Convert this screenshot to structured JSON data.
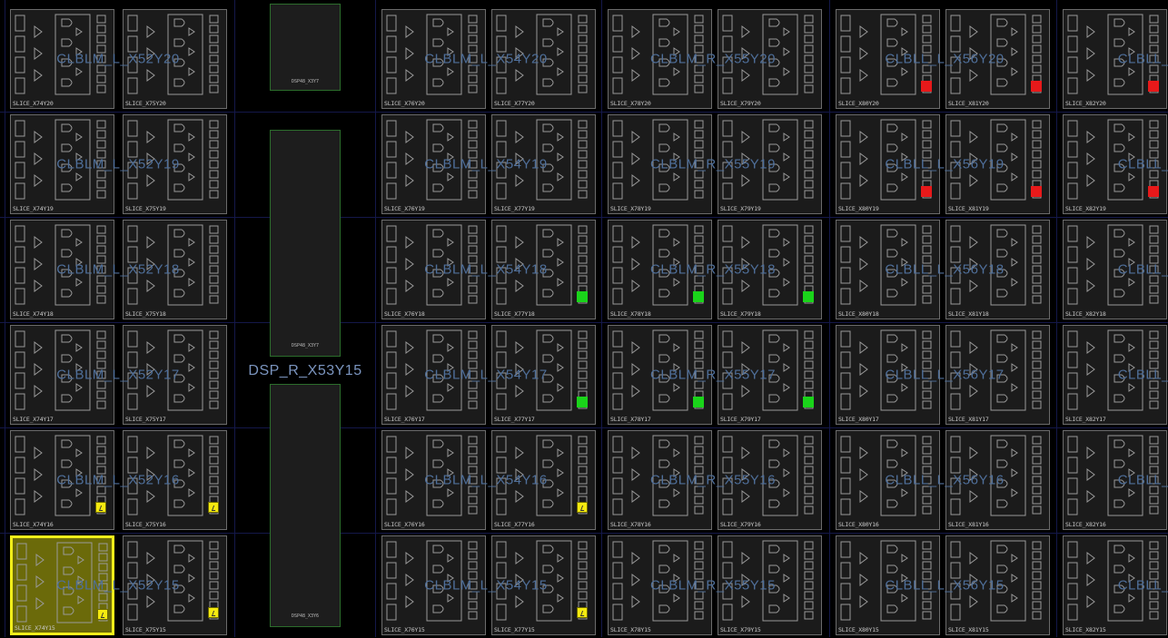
{
  "view": {
    "colors": {
      "background": "#000000",
      "slice_fill": "#1b1b1b",
      "slice_border": "#6b6b6b",
      "selected_fill": "#6b6a0a",
      "selected_border": "#f2ee1a",
      "marker_red": "#e8191a",
      "marker_green": "#1ad41a",
      "marker_yellow": "#f5ea10",
      "tile_label": "#4f6f9a",
      "dsp_border": "#2c6d2c"
    }
  },
  "rows": [
    {
      "y": 20,
      "slices": [
        {
          "label": "SLICE_X74Y20",
          "marker": null
        },
        {
          "label": "SLICE_X75Y20",
          "marker": null
        },
        {
          "label": "SLICE_X76Y20",
          "marker": null
        },
        {
          "label": "SLICE_X77Y20",
          "marker": null
        },
        {
          "label": "SLICE_X78Y20",
          "marker": null
        },
        {
          "label": "SLICE_X79Y20",
          "marker": null
        },
        {
          "label": "SLICE_X80Y20",
          "marker": "red"
        },
        {
          "label": "SLICE_X81Y20",
          "marker": "red"
        },
        {
          "label": "SLICE_X82Y20",
          "marker": "red"
        }
      ]
    },
    {
      "y": 19,
      "slices": [
        {
          "label": "SLICE_X74Y19",
          "marker": null
        },
        {
          "label": "SLICE_X75Y19",
          "marker": null
        },
        {
          "label": "SLICE_X76Y19",
          "marker": null
        },
        {
          "label": "SLICE_X77Y19",
          "marker": null
        },
        {
          "label": "SLICE_X78Y19",
          "marker": null
        },
        {
          "label": "SLICE_X79Y19",
          "marker": null
        },
        {
          "label": "SLICE_X80Y19",
          "marker": "red"
        },
        {
          "label": "SLICE_X81Y19",
          "marker": "red"
        },
        {
          "label": "SLICE_X82Y19",
          "marker": "red"
        }
      ]
    },
    {
      "y": 18,
      "slices": [
        {
          "label": "SLICE_X74Y18",
          "marker": null
        },
        {
          "label": "SLICE_X75Y18",
          "marker": null
        },
        {
          "label": "SLICE_X76Y18",
          "marker": null
        },
        {
          "label": "SLICE_X77Y18",
          "marker": "green"
        },
        {
          "label": "SLICE_X78Y18",
          "marker": "green"
        },
        {
          "label": "SLICE_X79Y18",
          "marker": "green"
        },
        {
          "label": "SLICE_X80Y18",
          "marker": null
        },
        {
          "label": "SLICE_X81Y18",
          "marker": null
        },
        {
          "label": "SLICE_X82Y18",
          "marker": null
        }
      ]
    },
    {
      "y": 17,
      "slices": [
        {
          "label": "SLICE_X74Y17",
          "marker": null
        },
        {
          "label": "SLICE_X75Y17",
          "marker": null
        },
        {
          "label": "SLICE_X76Y17",
          "marker": null
        },
        {
          "label": "SLICE_X77Y17",
          "marker": "green"
        },
        {
          "label": "SLICE_X78Y17",
          "marker": "green"
        },
        {
          "label": "SLICE_X79Y17",
          "marker": "green"
        },
        {
          "label": "SLICE_X80Y17",
          "marker": null
        },
        {
          "label": "SLICE_X81Y17",
          "marker": null
        },
        {
          "label": "SLICE_X82Y17",
          "marker": null
        }
      ]
    },
    {
      "y": 16,
      "slices": [
        {
          "label": "SLICE_X74Y16",
          "marker": "yellow"
        },
        {
          "label": "SLICE_X75Y16",
          "marker": "yellow"
        },
        {
          "label": "SLICE_X76Y16",
          "marker": null
        },
        {
          "label": "SLICE_X77Y16",
          "marker": "yellow"
        },
        {
          "label": "SLICE_X78Y16",
          "marker": null
        },
        {
          "label": "SLICE_X79Y16",
          "marker": null
        },
        {
          "label": "SLICE_X80Y16",
          "marker": null
        },
        {
          "label": "SLICE_X81Y16",
          "marker": null
        },
        {
          "label": "SLICE_X82Y16",
          "marker": null
        }
      ]
    },
    {
      "y": 15,
      "slices": [
        {
          "label": "SLICE_X74Y15",
          "marker": "yellow",
          "selected": true
        },
        {
          "label": "SLICE_X75Y15",
          "marker": "yellow"
        },
        {
          "label": "SLICE_X76Y15",
          "marker": null
        },
        {
          "label": "SLICE_X77Y15",
          "marker": "yellow"
        },
        {
          "label": "SLICE_X78Y15",
          "marker": null
        },
        {
          "label": "SLICE_X79Y15",
          "marker": null
        },
        {
          "label": "SLICE_X80Y15",
          "marker": null
        },
        {
          "label": "SLICE_X81Y15",
          "marker": null
        },
        {
          "label": "SLICE_X82Y15",
          "marker": null
        }
      ]
    }
  ],
  "tile_labels": [
    {
      "row": 20,
      "tiles": [
        "CLBLM_L_X52Y20",
        "CLBLM_L_X54Y20",
        "CLBLM_R_X55Y20",
        "CLBLL_L_X56Y20",
        "CLBLL_R"
      ]
    },
    {
      "row": 19,
      "tiles": [
        "CLBLM_L_X52Y19",
        "CLBLM_L_X54Y19",
        "CLBLM_R_X55Y19",
        "CLBLL_L_X56Y19",
        "CLBLL_R"
      ]
    },
    {
      "row": 18,
      "tiles": [
        "CLBLM_L_X52Y18",
        "CLBLM_L_X54Y18",
        "CLBLM_R_X55Y18",
        "CLBLL_L_X56Y18",
        "CLBLL_R"
      ]
    },
    {
      "row": 17,
      "tiles": [
        "CLBLM_L_X52Y17",
        "CLBLM_L_X54Y17",
        "CLBLM_R_X55Y17",
        "CLBLL_L_X56Y17",
        "CLBLL_R"
      ]
    },
    {
      "row": 16,
      "tiles": [
        "CLBLM_L_X52Y16",
        "CLBLM_L_X54Y16",
        "CLBLM_R_X55Y16",
        "CLBLL_L_X56Y16",
        "CLBLL_R"
      ]
    },
    {
      "row": 15,
      "tiles": [
        "CLBLM_L_X52Y15",
        "CLBLM_L_X54Y15",
        "CLBLM_R_X55Y15",
        "CLBLL_L_X56Y15",
        "CLBLL_R"
      ]
    }
  ],
  "dsp": {
    "tile_label": "DSP_R_X53Y15",
    "block_top_text": "DSP48_X3Y7",
    "block_bottom_text": "DSP48_X3Y6"
  }
}
